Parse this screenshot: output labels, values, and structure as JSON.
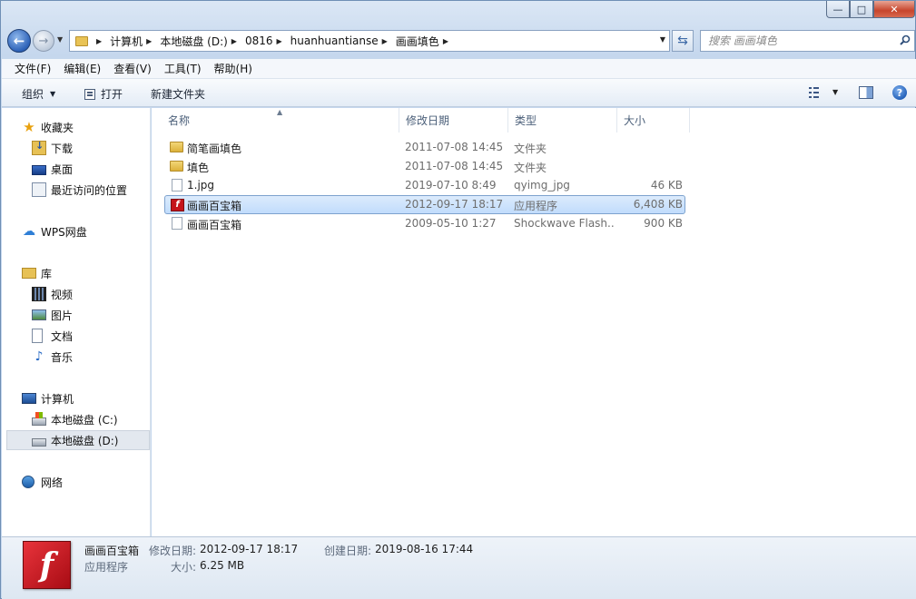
{
  "window": {
    "caption_min": "—",
    "caption_max": "□",
    "caption_close": "✕"
  },
  "nav": {
    "back_glyph": "←",
    "forward_glyph": "→",
    "refresh_glyph": "⇆"
  },
  "address": {
    "crumbs": [
      "计算机",
      "本地磁盘 (D:)",
      "0816",
      "huanhuantianse",
      "画画填色"
    ]
  },
  "search": {
    "placeholder": "搜索 画画填色"
  },
  "menubar": {
    "items": [
      "文件(F)",
      "编辑(E)",
      "查看(V)",
      "工具(T)",
      "帮助(H)"
    ]
  },
  "toolbar": {
    "organize": "组织",
    "open": "打开",
    "new_folder": "新建文件夹",
    "help": "?"
  },
  "sidebar": {
    "favorites": "收藏夹",
    "downloads": "下载",
    "desktop": "桌面",
    "recent": "最近访问的位置",
    "wps": "WPS网盘",
    "libraries": "库",
    "videos": "视频",
    "pictures": "图片",
    "documents": "文档",
    "music": "音乐",
    "computer": "计算机",
    "drive_c": "本地磁盘 (C:)",
    "drive_d": "本地磁盘 (D:)",
    "network": "网络"
  },
  "columns": {
    "name": "名称",
    "date": "修改日期",
    "type": "类型",
    "size": "大小"
  },
  "files": [
    {
      "name": "简笔画填色",
      "date": "2011-07-08 14:45",
      "type": "文件夹",
      "size": "",
      "icon": "folder-icon"
    },
    {
      "name": "填色",
      "date": "2011-07-08 14:45",
      "type": "文件夹",
      "size": "",
      "icon": "folder-icon"
    },
    {
      "name": "1.jpg",
      "date": "2019-07-10 8:49",
      "type": "qyimg_jpg",
      "size": "46 KB",
      "icon": "file-icon"
    },
    {
      "name": "画画百宝箱",
      "date": "2012-09-17 18:17",
      "type": "应用程序",
      "size": "6,408 KB",
      "icon": "flash-app-icon"
    },
    {
      "name": "画画百宝箱",
      "date": "2009-05-10 1:27",
      "type": "Shockwave Flash...",
      "size": "900 KB",
      "icon": "file-icon"
    }
  ],
  "details": {
    "name": "画画百宝箱",
    "type": "应用程序",
    "modified_label": "修改日期:",
    "modified_value": "2012-09-17 18:17",
    "created_label": "创建日期:",
    "created_value": "2019-08-16 17:44",
    "size_label": "大小:",
    "size_value": "6.25 MB",
    "flash_glyph": "f"
  }
}
